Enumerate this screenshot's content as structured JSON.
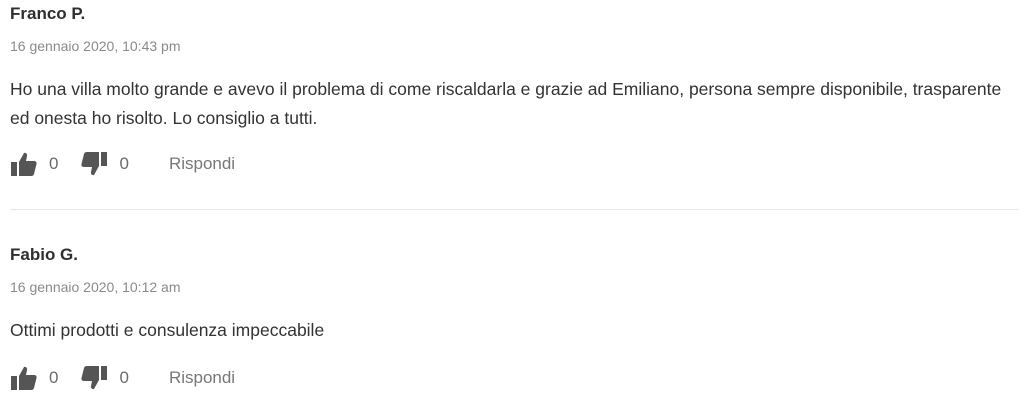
{
  "reviews": [
    {
      "author": "Franco P.",
      "date": "16 gennaio 2020, 10:43 pm",
      "text": "Ho una villa molto grande e avevo il problema di come riscaldarla e grazie ad Emiliano, persona sempre disponibile, trasparente ed onesta ho risolto. Lo consiglio a tutti.",
      "likes": "0",
      "dislikes": "0",
      "reply_label": "Rispondi"
    },
    {
      "author": "Fabio G.",
      "date": "16 gennaio 2020, 10:12 am",
      "text": "Ottimi prodotti e consulenza impeccabile",
      "likes": "0",
      "dislikes": "0",
      "reply_label": "Rispondi"
    }
  ],
  "icons": {
    "like": "thumbs-up-icon",
    "dislike": "thumbs-down-icon"
  },
  "colors": {
    "icon": "#555555",
    "author": "#2f2f2f",
    "date": "#8a8a8a",
    "text": "#333333",
    "divider": "#e6e6e6"
  }
}
